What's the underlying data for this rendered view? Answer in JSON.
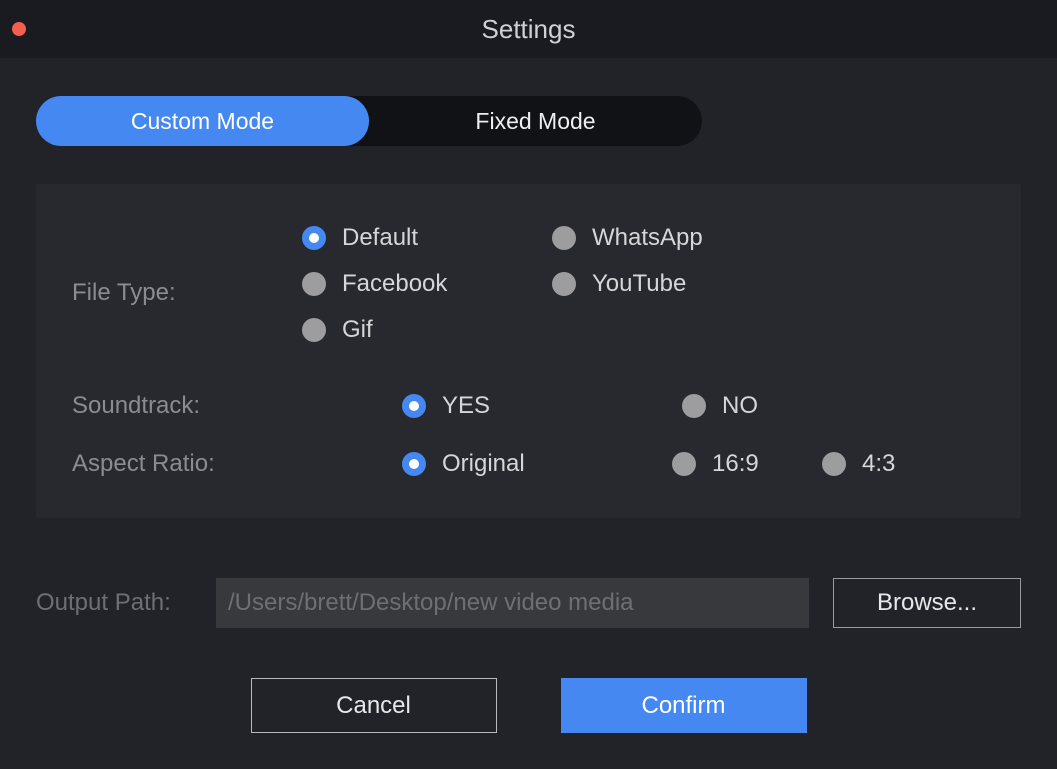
{
  "window": {
    "title": "Settings"
  },
  "tabs": {
    "custom": "Custom Mode",
    "fixed": "Fixed Mode"
  },
  "labels": {
    "file_type": "File Type:",
    "soundtrack": "Soundtrack:",
    "aspect_ratio": "Aspect Ratio:",
    "output_path": "Output Path:"
  },
  "file_type_options": {
    "default": "Default",
    "whatsapp": "WhatsApp",
    "facebook": "Facebook",
    "youtube": "YouTube",
    "gif": "Gif"
  },
  "soundtrack_options": {
    "yes": "YES",
    "no": "NO"
  },
  "aspect_options": {
    "original": "Original",
    "r16_9": "16:9",
    "r4_3": "4:3"
  },
  "output": {
    "path": "/Users/brett/Desktop/new video media",
    "browse": "Browse..."
  },
  "buttons": {
    "cancel": "Cancel",
    "confirm": "Confirm"
  }
}
